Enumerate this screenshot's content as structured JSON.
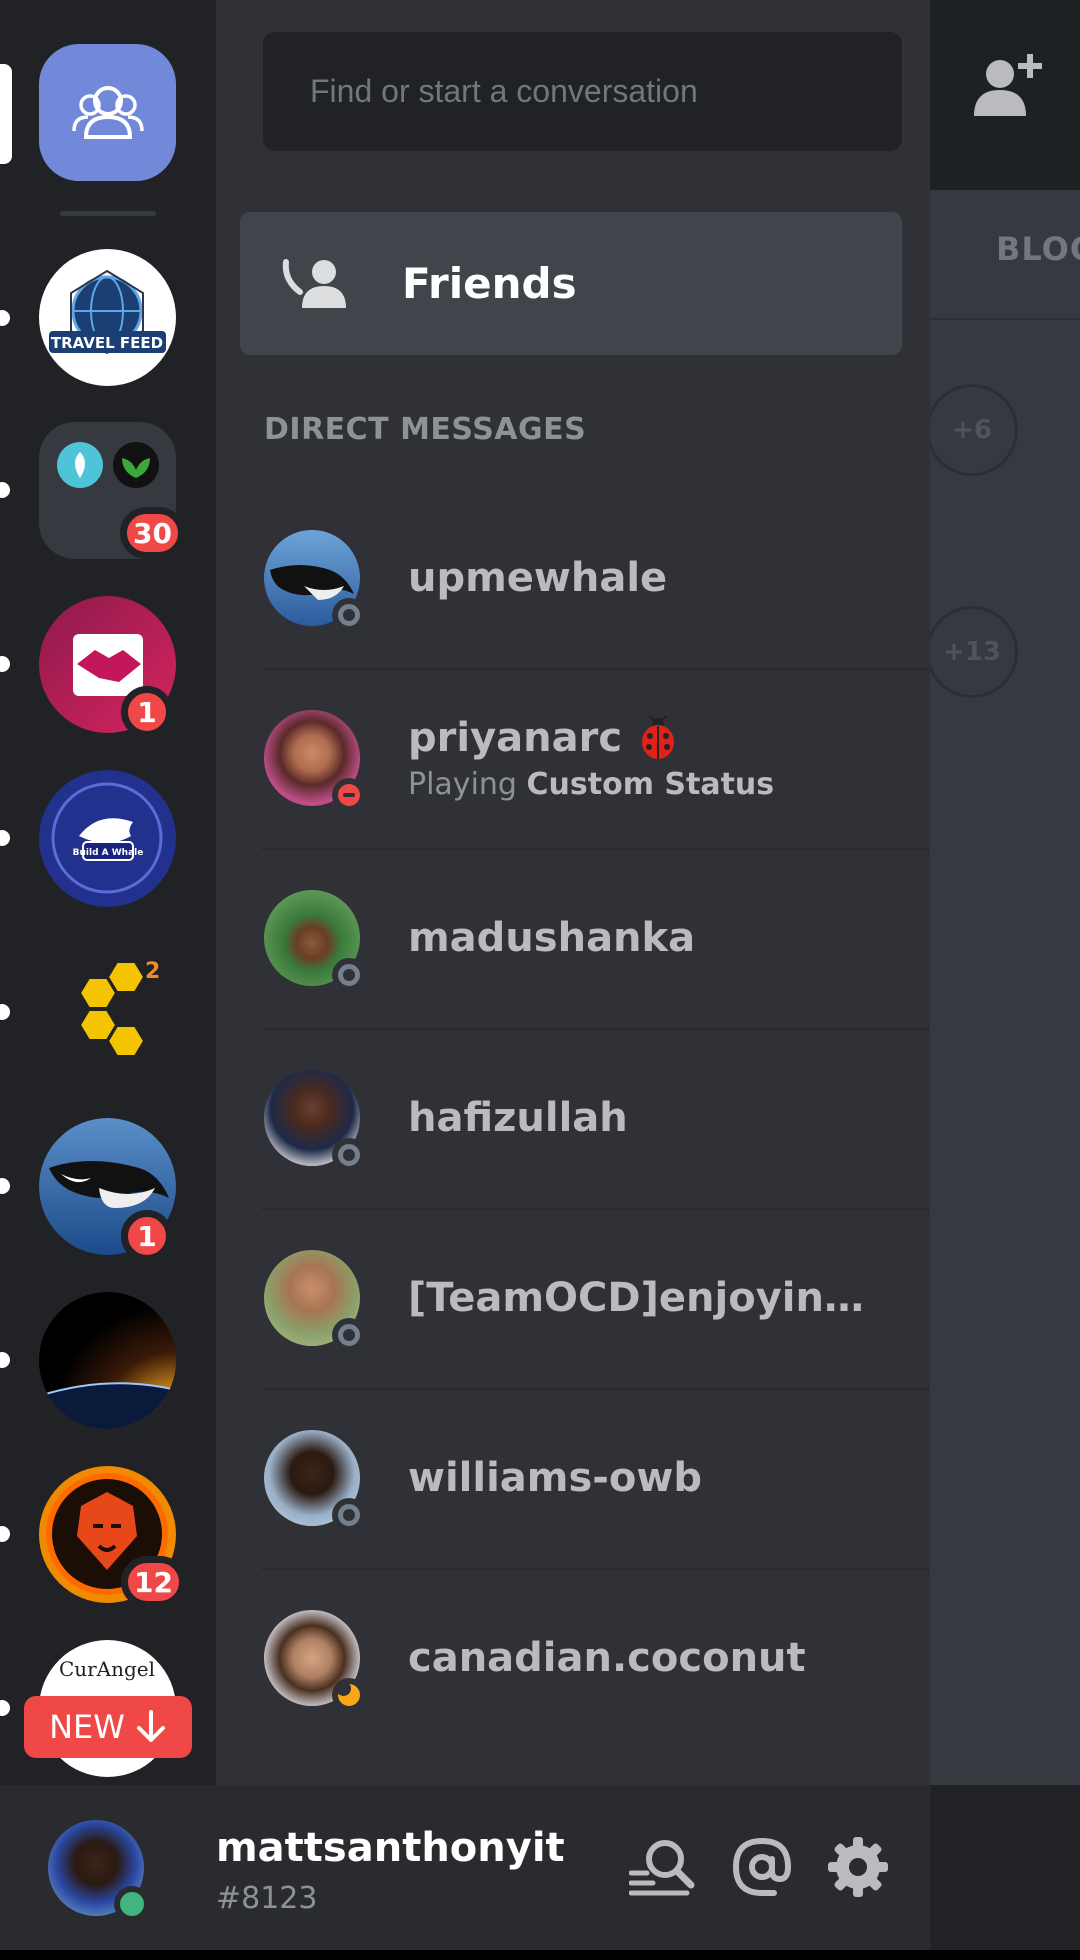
{
  "search": {
    "placeholder": "Find or start a conversation"
  },
  "friends": {
    "label": "Friends"
  },
  "direct_messages": {
    "header": "DIRECT MESSAGES",
    "items": [
      {
        "name": "upmewhale",
        "status": "offline"
      },
      {
        "name": "priyanarc",
        "status": "dnd",
        "activity_prefix": "Playing",
        "activity_name": "Custom Status",
        "emoji": "ladybug-icon"
      },
      {
        "name": "madushanka",
        "status": "offline"
      },
      {
        "name": "hafizullah",
        "status": "offline"
      },
      {
        "name": "[TeamOCD]enjoying...",
        "status": "offline"
      },
      {
        "name": "williams-owb",
        "status": "offline"
      },
      {
        "name": "canadian.coconut",
        "status": "idle"
      }
    ]
  },
  "servers": {
    "travel_feed": {
      "label": "TRAVEL FEED"
    },
    "folder": {
      "badge": "30"
    },
    "handshake": {
      "badge": "1"
    },
    "whale_server": {
      "label": "Build A Whale"
    },
    "hive": {
      "count": "2"
    },
    "orca": {
      "badge": "1"
    },
    "lion": {
      "badge": "12"
    },
    "curangel": {
      "label": "CurAngel"
    },
    "new_pill": {
      "label": "NEW"
    }
  },
  "main": {
    "blocked_tab": "BLOCKED",
    "more_counts": [
      "+6",
      "+13"
    ]
  },
  "user": {
    "name": "mattsanthonyit",
    "tag": "#8123"
  },
  "colors": {
    "blurple": "#7289da",
    "red": "#f04747",
    "green": "#43b581",
    "idle": "#faa61a"
  }
}
